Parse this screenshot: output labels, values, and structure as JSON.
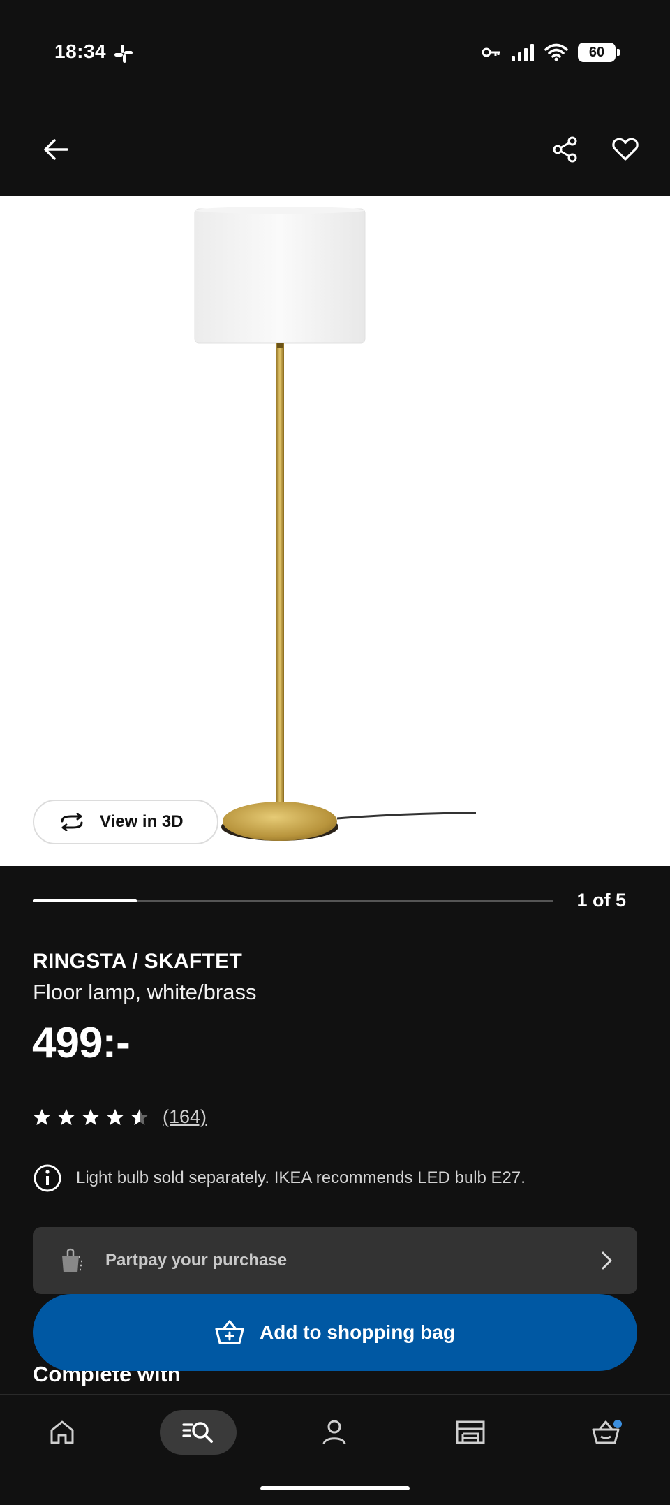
{
  "status": {
    "time": "18:34",
    "battery": "60"
  },
  "product": {
    "name": "RINGSTA / SKAFTET",
    "description": "Floor lamp, white/brass",
    "price": "499:-",
    "rating": 4.5,
    "reviews": "(164)",
    "notice": "Light bulb sold separately. IKEA recommends LED bulb E27."
  },
  "gallery": {
    "view3d_label": "View in 3D",
    "pager_label": "1 of 5",
    "progress": 0.2
  },
  "partpay": {
    "label": "Partpay your purchase"
  },
  "cta": {
    "add_label": "Add to shopping bag"
  },
  "section": {
    "complete_with": "Complete with"
  },
  "nav": {
    "items": [
      "home-icon",
      "search-icon",
      "profile-icon",
      "store-icon",
      "basket-icon"
    ],
    "active": "search-icon"
  },
  "colors": {
    "background": "#111111",
    "accent_blue": "#0058a3",
    "brass": "#c9a94a"
  }
}
